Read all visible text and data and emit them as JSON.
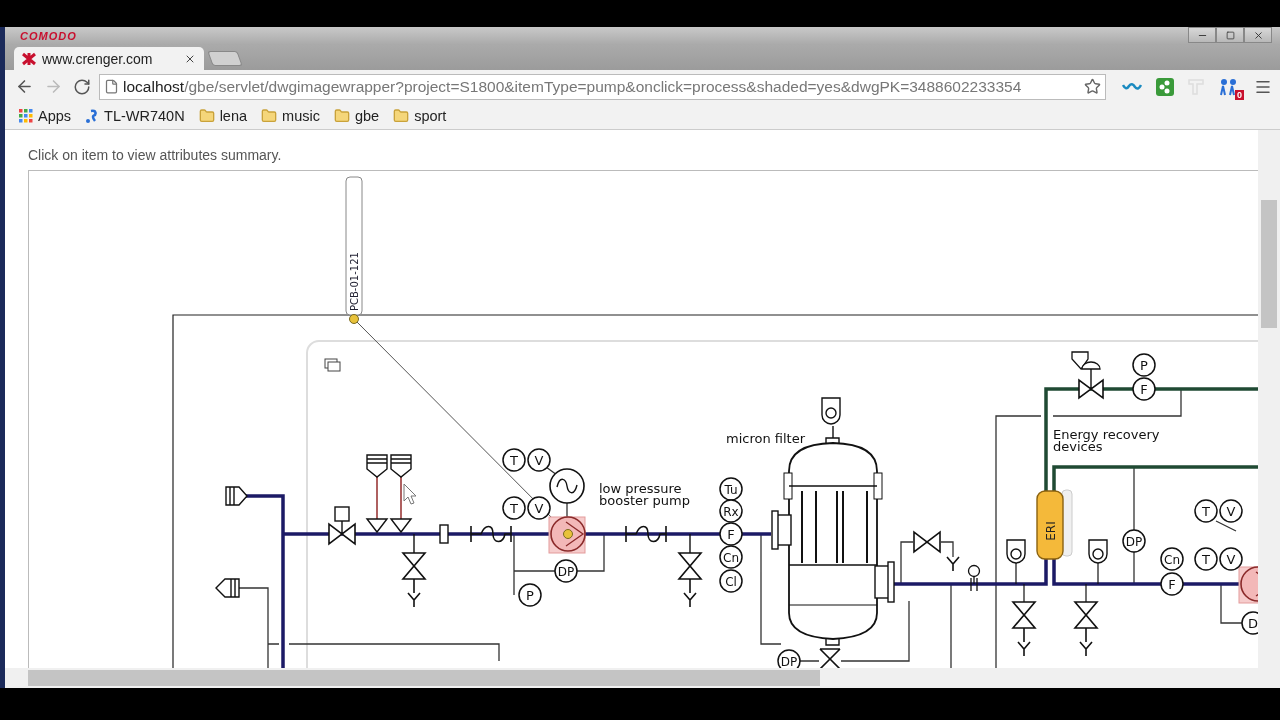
{
  "browser": {
    "brand": "COMODO",
    "tabs": [
      {
        "title": "www.crenger.com",
        "selected": true
      }
    ],
    "address": {
      "host": "localhost",
      "path": "/gbe/servlet/dwgimagewrapper?project=S1800&itemType=pump&onclick=process&shaded=yes&dwgPK=3488602233354"
    },
    "extension_badge": "0",
    "bookmarks": [
      {
        "label": "Apps",
        "kind": "apps"
      },
      {
        "label": "TL-WR740N",
        "kind": "site"
      },
      {
        "label": "lena",
        "kind": "folder"
      },
      {
        "label": "music",
        "kind": "folder"
      },
      {
        "label": "gbe",
        "kind": "folder"
      },
      {
        "label": "sport",
        "kind": "folder"
      }
    ]
  },
  "page": {
    "hint": "Click on item to view attributes summary.",
    "diagram": {
      "tag": "PCB-01-121",
      "labels": [
        {
          "lines": [
            "low pressure",
            "booster pump"
          ]
        },
        {
          "lines": [
            "micron filter"
          ]
        },
        {
          "lines": [
            "Energy recovery",
            "devices"
          ]
        }
      ],
      "eri": "ERI",
      "pumps": [
        {
          "highlighted": true
        },
        {
          "highlighted": true
        }
      ],
      "instruments": [
        {
          "text": "T"
        },
        {
          "text": "V"
        },
        {
          "text": "T"
        },
        {
          "text": "V"
        },
        {
          "text": "DP"
        },
        {
          "text": "P"
        },
        {
          "text": "Tu"
        },
        {
          "text": "Rx"
        },
        {
          "text": "F"
        },
        {
          "text": "Cn"
        },
        {
          "text": "Cl"
        },
        {
          "text": "DP"
        },
        {
          "text": "P"
        },
        {
          "text": "F"
        },
        {
          "text": "DP"
        },
        {
          "text": "Cn"
        },
        {
          "text": "F"
        },
        {
          "text": "T"
        },
        {
          "text": "V"
        },
        {
          "text": "T"
        },
        {
          "text": "V"
        },
        {
          "text": "D"
        }
      ]
    }
  }
}
